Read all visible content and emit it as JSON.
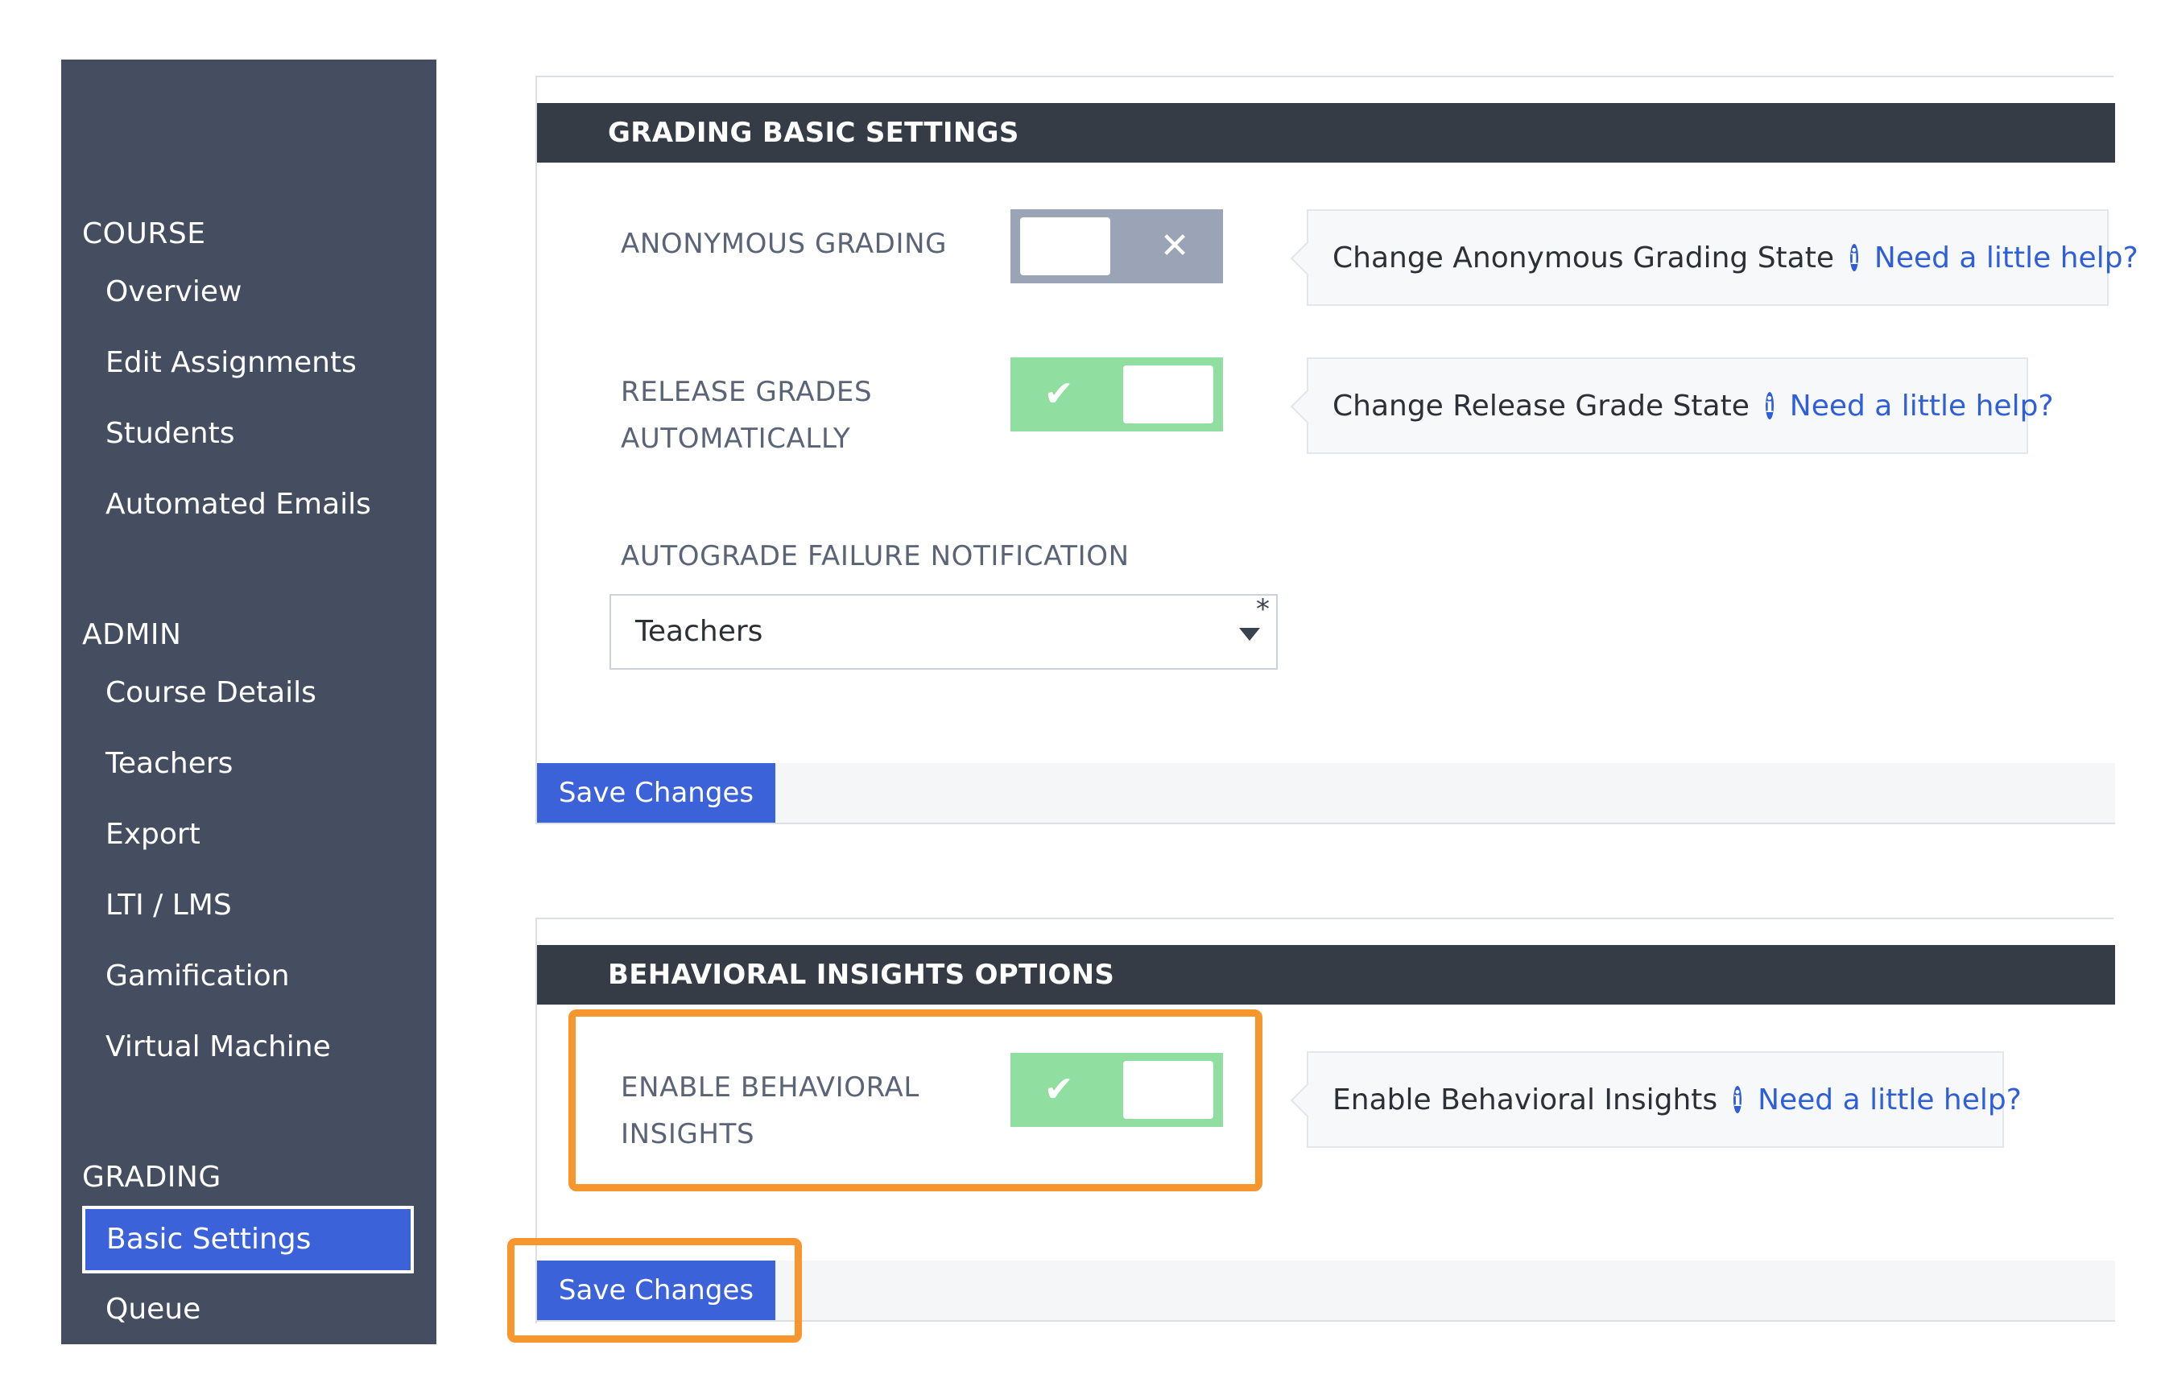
{
  "sidebar": {
    "course_heading": "COURSE",
    "course_items": [
      "Overview",
      "Edit Assignments",
      "Students",
      "Automated Emails"
    ],
    "admin_heading": "ADMIN",
    "admin_items": [
      "Course Details",
      "Teachers",
      "Export",
      "LTI / LMS",
      "Gamification",
      "Virtual Machine"
    ],
    "grading_heading": "GRADING",
    "grading_items": [
      "Basic Settings",
      "Queue"
    ],
    "active_item": "Basic Settings"
  },
  "grading_panel": {
    "title": "GRADING BASIC SETTINGS",
    "anonymous_grading": {
      "label": "ANONYMOUS GRADING",
      "state": "off",
      "help_text": "Change Anonymous Grading State",
      "help_link": "Need a little help?"
    },
    "release_grades": {
      "label_line1": "RELEASE GRADES",
      "label_line2": "AUTOMATICALLY",
      "state": "on",
      "help_text": "Change Release Grade State",
      "help_link": "Need a little help?"
    },
    "autograde_failure": {
      "label": "AUTOGRADE FAILURE NOTIFICATION",
      "value": "Teachers",
      "required_mark": "*"
    },
    "save_label": "Save Changes"
  },
  "insights_panel": {
    "title": "BEHAVIORAL INSIGHTS OPTIONS",
    "enable_insights": {
      "label_line1": "ENABLE BEHAVIORAL",
      "label_line2": "INSIGHTS",
      "state": "on",
      "help_text": "Enable Behavioral Insights",
      "help_link": "Need a little help?"
    },
    "save_label": "Save Changes"
  },
  "icons": {
    "toggle_off": "close-icon",
    "toggle_on": "check-icon",
    "info": "info-icon",
    "dropdown": "caret-down-icon"
  },
  "colors": {
    "sidebar_bg": "#444e60",
    "header_bg": "#363c46",
    "accent": "#3b62d9",
    "toggle_on": "#90dea0",
    "toggle_off": "#9aa4b6",
    "highlight": "#f8962e"
  }
}
